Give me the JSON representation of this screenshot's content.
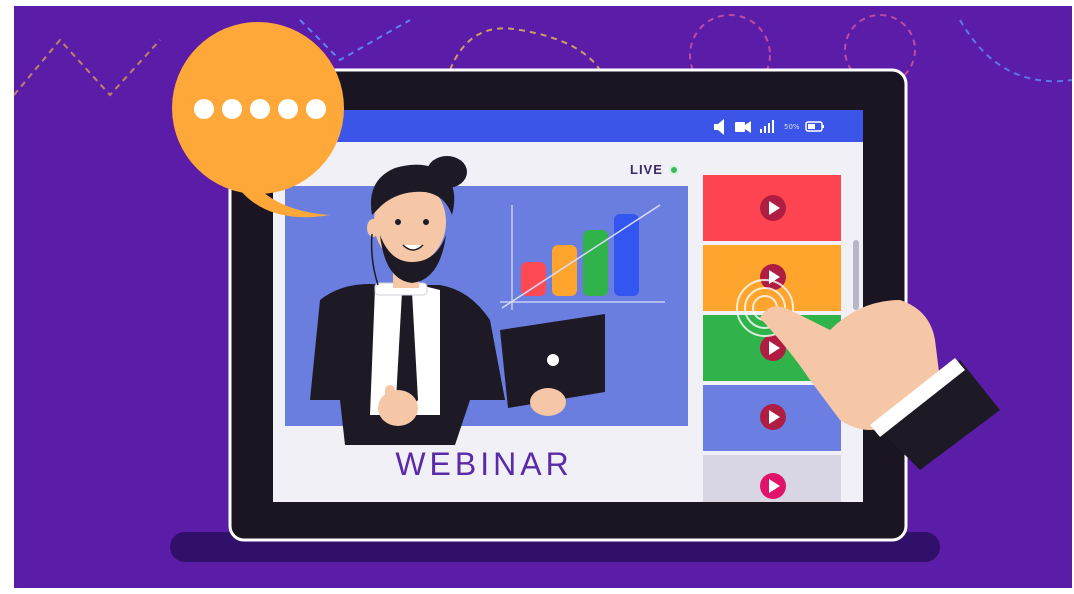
{
  "screen": {
    "live_label": "LIVE",
    "title": "WEBINAR",
    "battery_percent": "50%"
  },
  "status_bar_icons": [
    "volume-icon",
    "camera-icon",
    "signal-icon",
    "battery-icon"
  ],
  "playlist": {
    "items": [
      {
        "color": "#ff4451",
        "icon": "play-icon"
      },
      {
        "color": "#ffa42d",
        "icon": "play-icon"
      },
      {
        "color": "#2fb34a",
        "icon": "play-icon"
      },
      {
        "color": "#6b7fe3",
        "icon": "play-icon"
      },
      {
        "color": "#d8d6e4",
        "icon": "play-icon"
      }
    ]
  },
  "speech_bubble": {
    "dots": 5,
    "color": "#ffa83a"
  },
  "chart": {
    "bar_colors": [
      "#ff4a55",
      "#ffa42d",
      "#2fb34a",
      "#3355f0"
    ],
    "bar_values": [
      2,
      3,
      4,
      5
    ]
  },
  "colors": {
    "background": "#5b1ca8",
    "tablet_frame": "#1a1520",
    "header_bar": "#3a55e8",
    "video_panel": "#6a7ee0",
    "screen": "#f1f0f6"
  }
}
